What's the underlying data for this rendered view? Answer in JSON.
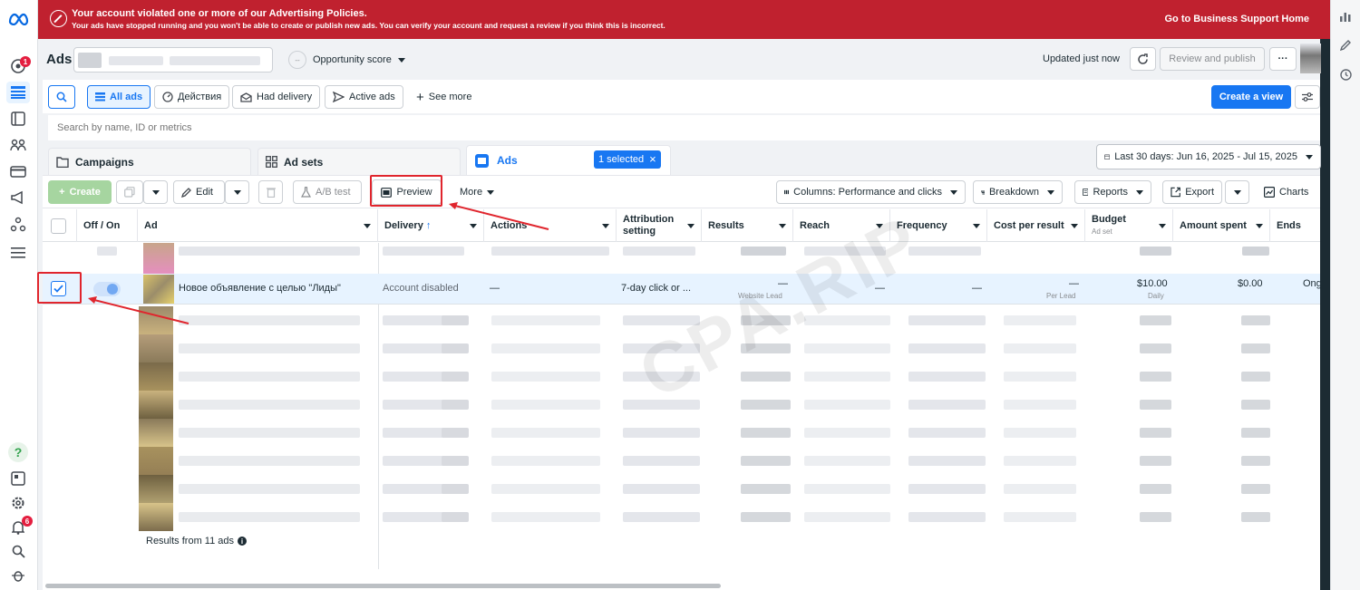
{
  "banner": {
    "title": "Your account violated one or more of our Advertising Policies.",
    "message": "Your ads have stopped running and you won't be able to create or publish new ads. You can verify your account and request a review if you think this is incorrect.",
    "link": "Go to Business Support Home",
    "color": "#c0212f"
  },
  "left_rail": {
    "notification_badge_top": "1",
    "notification_badge_bottom": "6",
    "help_glyph": "?"
  },
  "header": {
    "title": "Ads",
    "opportunity_score": "Opportunity score",
    "opportunity_dash": "--",
    "updated": "Updated just now",
    "review_publish": "Review and publish",
    "more_glyph": "···"
  },
  "filters": {
    "all_ads": "All ads",
    "actions": "Действия",
    "had_delivery": "Had delivery",
    "active_ads": "Active ads",
    "see_more": "See more",
    "create_view": "Create a view"
  },
  "search": {
    "placeholder": "Search by name, ID or metrics"
  },
  "tabs": {
    "campaigns": "Campaigns",
    "ad_sets": "Ad sets",
    "ads": "Ads",
    "selected": "1 selected",
    "date_range": "Last 30 days: Jun 16, 2025 - Jul 15, 2025"
  },
  "toolbar": {
    "create": "Create",
    "edit": "Edit",
    "ab_test": "A/B test",
    "preview": "Preview",
    "more": "More",
    "columns": "Columns: Performance and clicks",
    "breakdown": "Breakdown",
    "reports": "Reports",
    "export": "Export",
    "charts": "Charts"
  },
  "table": {
    "headers": {
      "off_on": "Off / On",
      "ad": "Ad",
      "delivery": "Delivery",
      "actions": "Actions",
      "attribution": "Attribution setting",
      "results": "Results",
      "reach": "Reach",
      "frequency": "Frequency",
      "cost_per_result": "Cost per result",
      "budget": "Budget",
      "budget_sub": "Ad set",
      "amount_spent": "Amount spent",
      "ends": "Ends"
    },
    "selected_row": {
      "ad_name": "Новое объявление с целью \"Лиды\"",
      "delivery": "Account disabled",
      "actions": "—",
      "attribution": "7-day click or ...",
      "results": "—",
      "results_sub": "Website Lead",
      "reach": "—",
      "frequency": "—",
      "cost_per_result": "—",
      "cost_sub": "Per Lead",
      "budget": "$10.00",
      "budget_sub": "Daily",
      "amount_spent": "$0.00",
      "ends": "Ongo"
    },
    "footer": "Results from 11 ads"
  },
  "watermark": "CPA.RIP",
  "colors": {
    "accent": "#1877f2",
    "annotation": "#e0252d"
  }
}
